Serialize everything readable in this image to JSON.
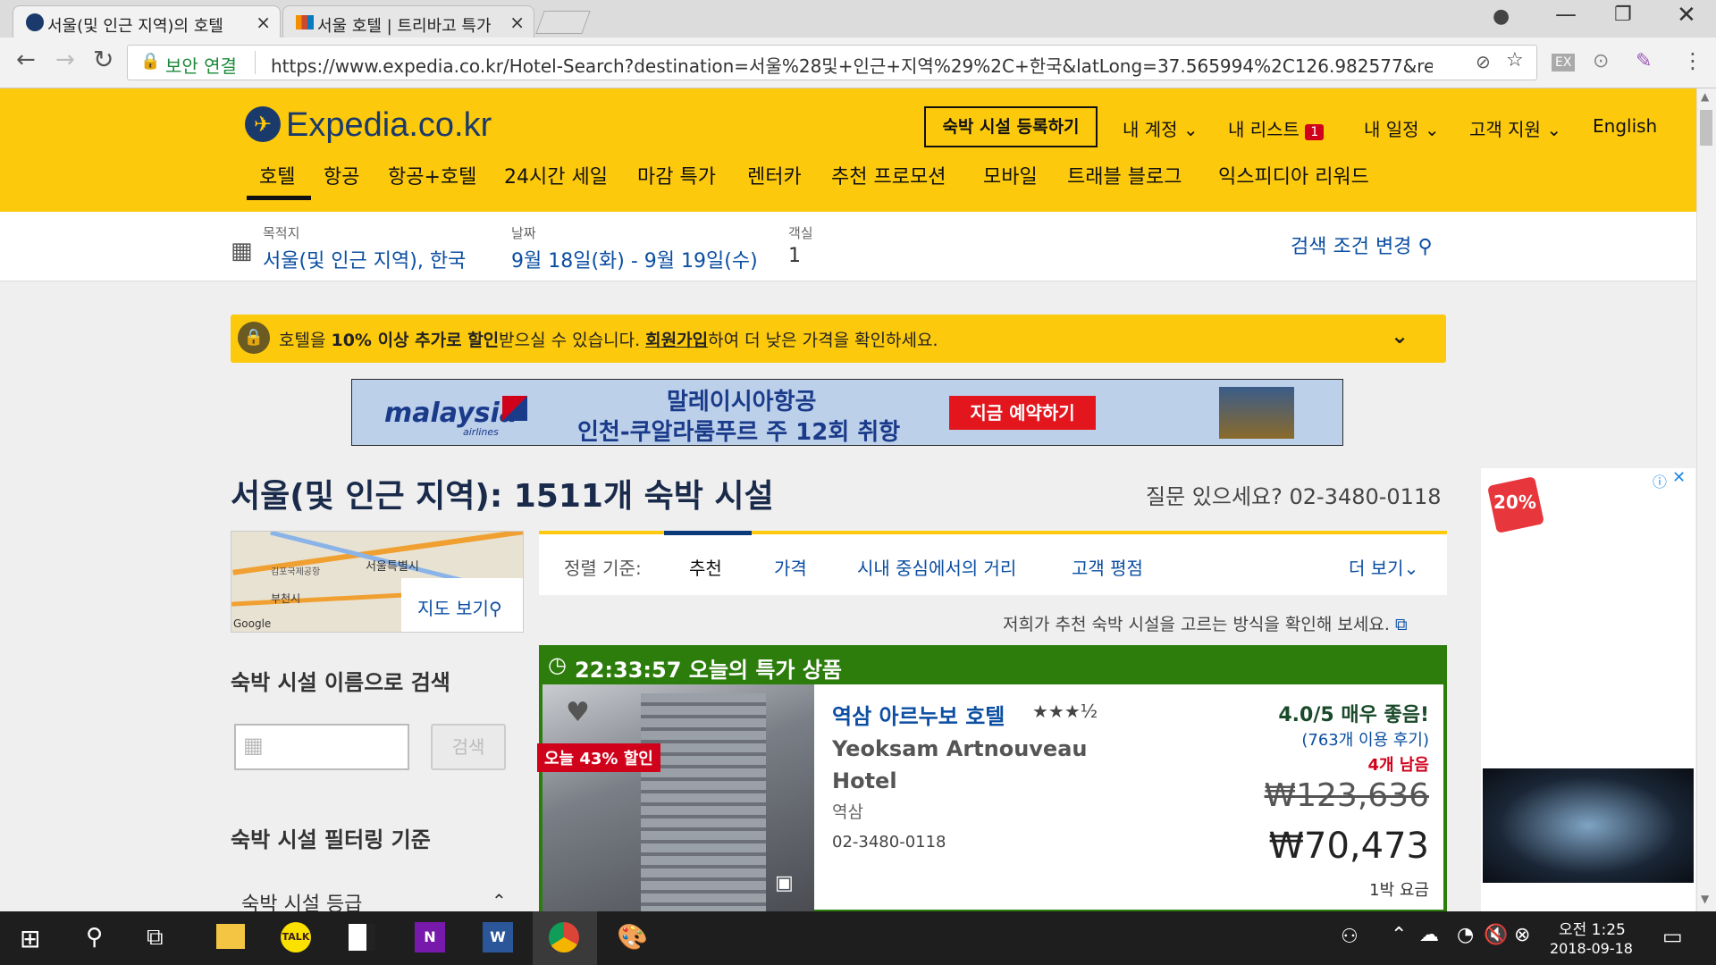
{
  "browser": {
    "tabs": [
      {
        "title": "서울(및 인근 지역)의 호텔"
      },
      {
        "title": "서울 호텔 | 트리바고 특가"
      }
    ],
    "secure_label": "보안 연결",
    "url": "https://www.expedia.co.kr/Hotel-Search?destination=서울%28및+인근+지역%29%2C+한국&latLong=37.565994%2C126.982577&regionId..."
  },
  "header": {
    "logo_text": "Expedia.co.kr",
    "register_button": "숙박 시설 등록하기",
    "account": "내 계정",
    "my_list": "내 리스트",
    "my_list_badge": "1",
    "itinerary": "내 일정",
    "support": "고객 지원",
    "language": "English",
    "nav": [
      "호텔",
      "항공",
      "항공+호텔",
      "24시간 세일",
      "마감 특가",
      "렌터카",
      "추천 프로모션",
      "모바일",
      "트래블 블로그",
      "익스피디아 리워드"
    ]
  },
  "search": {
    "dest_label": "목적지",
    "dest_value": "서울(및 인근 지역), 한국",
    "date_label": "날짜",
    "date_value": "9월 18일(화) - 9월 19일(수)",
    "guest_label": "객실",
    "guest_value": "1",
    "modify": "검색 조건 변경"
  },
  "promo": {
    "pre": "호텔을 ",
    "bold": "10% 이상 추가로 할인",
    "mid": "받으실 수 있습니다. ",
    "link": "회원가입",
    "post": "하여 더 낮은 가격을 확인하세요."
  },
  "ad": {
    "brand": "malaysia",
    "brand_sub": "airlines",
    "line1": "말레이시아항공",
    "line2": "인천-쿠알라룸푸르 주 12회 취항",
    "cta": "지금 예약하기"
  },
  "results": {
    "title": "서울(및 인근 지역): 1511개 숙박 시설",
    "phone": "질문 있으세요? 02-3480-0118",
    "map_link": "지도 보기",
    "map_labels": [
      "서울특별시",
      "부천시",
      "김포국제공항",
      "Google"
    ],
    "search_name_title": "숙박 시설 이름으로 검색",
    "search_button": "검색",
    "filter_title": "숙박 시설 필터링 기준",
    "filter_star": "숙박 시설 등급"
  },
  "sort": {
    "label": "정렬 기준:",
    "options": [
      "추천",
      "가격",
      "시내 중심에서의 거리",
      "고객 평점"
    ],
    "more": "더 보기",
    "how_we_recommend": "저희가 추천 숙박 시설을 고르는 방식을 확인해 보세요."
  },
  "deal": {
    "timer": "22:33:57 오늘의 특가 상품",
    "discount_badge": "오늘 43% 할인",
    "name_kr": "역삼 아르누보 호텔",
    "name_en": "Yeoksam Artnouveau Hotel",
    "area": "역삼",
    "phone": "02-3480-0118",
    "rating": "4.0/5 매우 좋음!",
    "reviews": "(763개 이용 후기)",
    "left": "4개 남음",
    "old_price": "₩123,636",
    "price": "₩70,473",
    "per_night": "1박 요금",
    "stars": 3.5
  },
  "right_ad": {
    "badge": "20%"
  },
  "taskbar": {
    "time": "오전 1:25",
    "date": "2018-09-18"
  },
  "colors": {
    "brand_yellow": "#fdc90c",
    "link_blue": "#0b4ea2",
    "deal_green": "#2d7d0d",
    "sale_red": "#d0021b"
  }
}
